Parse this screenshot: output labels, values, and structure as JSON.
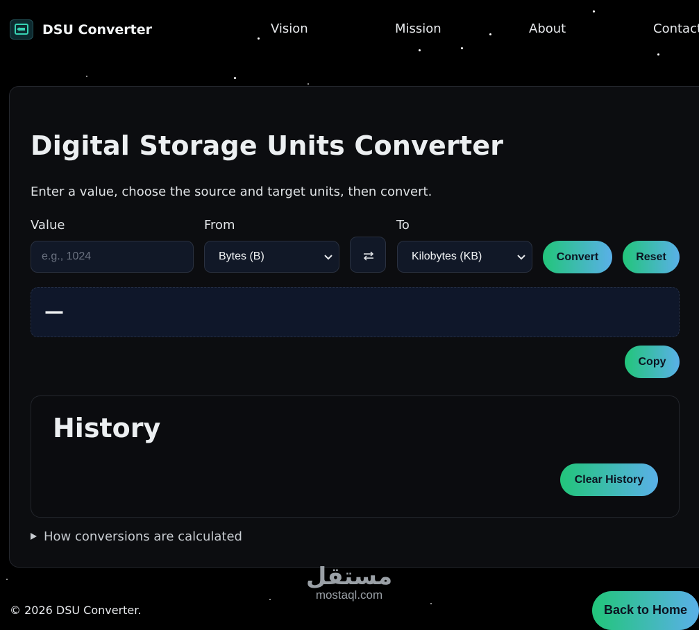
{
  "brand": {
    "name": "DSU Converter",
    "icon": "drive-icon"
  },
  "nav": {
    "links": [
      "Vision",
      "Mission",
      "About",
      "Contact"
    ]
  },
  "converter": {
    "title": "Digital Storage Units Converter",
    "subtitle": "Enter a value, choose the source and target units, then convert.",
    "value_label": "Value",
    "value_placeholder": "e.g., 1024",
    "from_label": "From",
    "from_selected": "Bytes (B)",
    "to_label": "To",
    "to_selected": "Kilobytes (KB)",
    "swap_icon": "swap-arrows-icon",
    "convert_label": "Convert",
    "reset_label": "Reset",
    "result": "—",
    "copy_label": "Copy"
  },
  "history": {
    "title": "History",
    "clear_label": "Clear History"
  },
  "details": {
    "summary": "How conversions are calculated"
  },
  "watermark": {
    "arabic": "مستقل",
    "latin": "mostaql.com"
  },
  "footer": {
    "copyright": "© 2026 DSU Converter.",
    "back_label": "Back to Home"
  },
  "colors": {
    "accent_start": "#22c57a",
    "accent_end": "#5ab0e8",
    "background": "#000000"
  }
}
